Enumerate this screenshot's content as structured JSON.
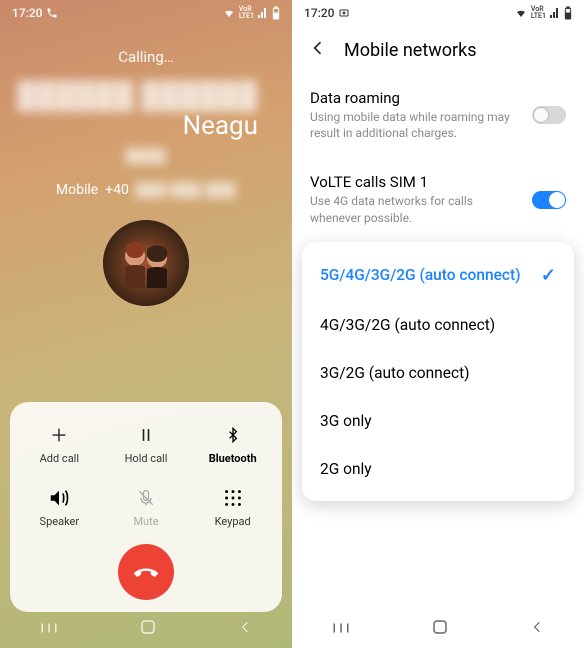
{
  "left": {
    "statusbar": {
      "time": "17:20"
    },
    "calling_label": "Calling…",
    "contact_name": "Neagu",
    "phone_type": "Mobile",
    "phone_prefix": "+40",
    "actions": {
      "add_call": "Add call",
      "hold_call": "Hold call",
      "bluetooth": "Bluetooth",
      "speaker": "Speaker",
      "mute": "Mute",
      "keypad": "Keypad"
    }
  },
  "right": {
    "statusbar": {
      "time": "17:20"
    },
    "header_title": "Mobile networks",
    "settings": {
      "roaming": {
        "title": "Data roaming",
        "desc": "Using mobile data while roaming may result in additional charges.",
        "enabled": false
      },
      "volte": {
        "title": "VoLTE calls SIM 1",
        "desc": "Use 4G data networks for calls whenever possible.",
        "enabled": true
      }
    },
    "network_modes": [
      "5G/4G/3G/2G (auto connect)",
      "4G/3G/2G (auto connect)",
      "3G/2G (auto connect)",
      "3G only",
      "2G only"
    ],
    "selected_mode": 0
  }
}
